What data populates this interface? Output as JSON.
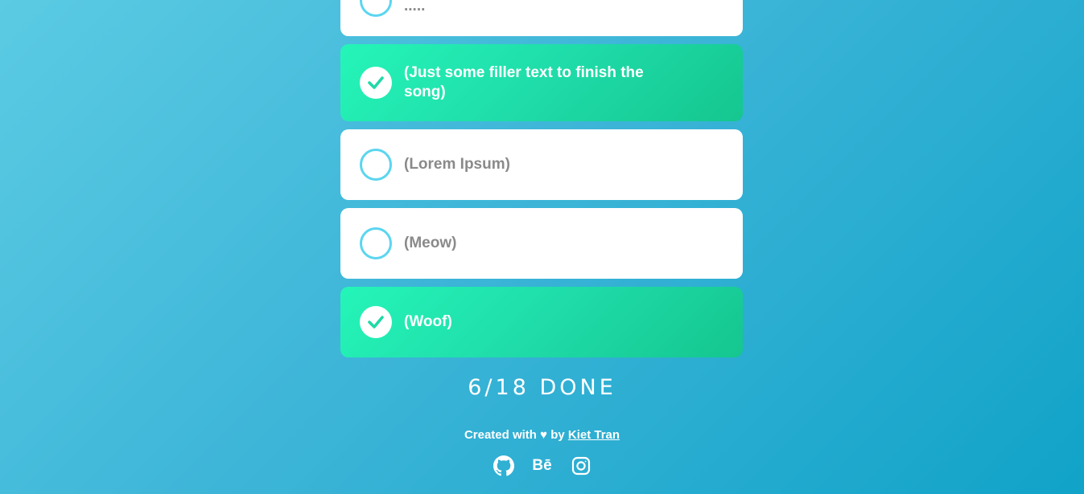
{
  "todos": [
    {
      "label": ".....",
      "done": false
    },
    {
      "label": "(Just some filler text to finish the song)",
      "done": true
    },
    {
      "label": "(Lorem Ipsum)",
      "done": false
    },
    {
      "label": "(Meow)",
      "done": false
    },
    {
      "label": "(Woof)",
      "done": true
    }
  ],
  "footer": {
    "counter": "6/18 DONE",
    "credit_prefix": "Created with ♥ by",
    "author": "Kiet Tran",
    "behance_label": "Bē"
  },
  "colors": {
    "pending_ring": "#5bd5f0",
    "done_gradient_start": "#25f5b8",
    "done_gradient_end": "#15c68f",
    "check": "#20d9a7"
  },
  "icons": [
    "check-icon",
    "github-icon",
    "behance-icon",
    "instagram-icon"
  ]
}
